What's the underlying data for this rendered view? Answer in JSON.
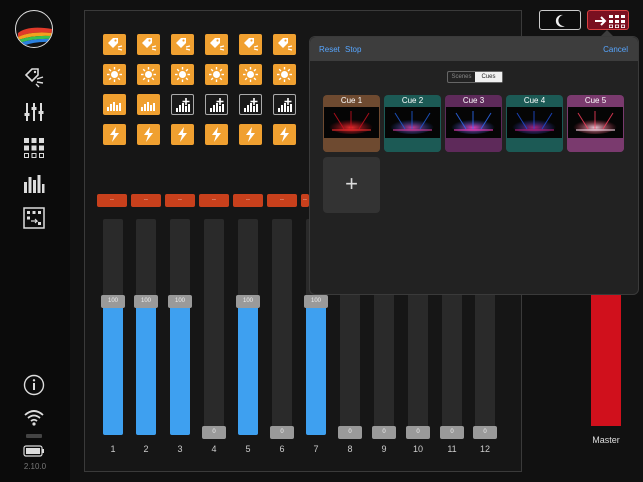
{
  "app": {
    "version": "2.10.0"
  },
  "sidebar": {
    "icons": [
      "logo-icon",
      "fixture-tag-icon",
      "faders-icon",
      "grid-icon",
      "levels-icon",
      "program-icon",
      "info-icon",
      "wifi-icon",
      "battery-icon"
    ]
  },
  "top_buttons": {
    "night": "moon-icon",
    "cues_toggle": "arrow-grid-icon"
  },
  "flash_buttons": [
    "..",
    "..",
    "..",
    "..",
    "..",
    "..",
    "..",
    ".."
  ],
  "faders": [
    {
      "label": "1",
      "value_label": "100",
      "level": 0.62
    },
    {
      "label": "2",
      "value_label": "100",
      "level": 0.62
    },
    {
      "label": "3",
      "value_label": "100",
      "level": 0.62
    },
    {
      "label": "4",
      "value_label": "0",
      "level": 0
    },
    {
      "label": "5",
      "value_label": "100",
      "level": 0.62
    },
    {
      "label": "6",
      "value_label": "0",
      "level": 0
    },
    {
      "label": "7",
      "value_label": "100",
      "level": 0.62
    },
    {
      "label": "8",
      "value_label": "0",
      "level": 0
    },
    {
      "label": "9",
      "value_label": "0",
      "level": 0
    },
    {
      "label": "10",
      "value_label": "0",
      "level": 0
    },
    {
      "label": "11",
      "value_label": "0",
      "level": 0
    },
    {
      "label": "12",
      "value_label": "0",
      "level": 0
    }
  ],
  "master": {
    "label": "Master",
    "level": 0.63,
    "color": "#d0101c"
  },
  "popover": {
    "reset_label": "Reset",
    "stop_label": "Stop",
    "cancel_label": "Cancel",
    "segments": [
      "Scenes",
      "Cues"
    ],
    "selected_segment": "Cues",
    "cues": [
      {
        "title": "Cue 1",
        "color": "#6e4a30"
      },
      {
        "title": "Cue 2",
        "color": "#1c5a55"
      },
      {
        "title": "Cue 3",
        "color": "#5e2a5a"
      },
      {
        "title": "Cue 4",
        "color": "#1c5a55"
      },
      {
        "title": "Cue 5",
        "color": "#7a3a6e"
      }
    ],
    "add_label": "+"
  },
  "colors": {
    "accent_orange": "#f0a030",
    "fader_blue": "#3ea0f0",
    "flash_red": "#c8401c",
    "link_blue": "#57a6ff"
  }
}
